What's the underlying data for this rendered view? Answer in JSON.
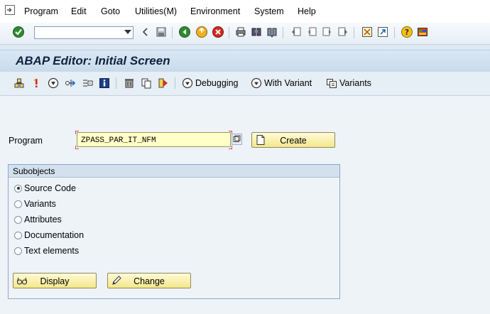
{
  "menu": {
    "items": [
      "Program",
      "Edit",
      "Goto",
      "Utilities(M)",
      "Environment",
      "System",
      "Help"
    ]
  },
  "system_toolbar": {
    "command_field_value": "",
    "icons": [
      "enter-icon",
      "back-nav-icon",
      "save-icon",
      "back-icon",
      "exit-icon",
      "cancel-icon",
      "print-icon",
      "find-icon",
      "find-next-icon",
      "first-page-icon",
      "prev-page-icon",
      "next-page-icon",
      "last-page-icon",
      "new-session-icon",
      "shortcut-icon",
      "help-icon",
      "customize-layout-icon"
    ]
  },
  "title": "ABAP Editor: Initial Screen",
  "app_toolbar": {
    "debugging_label": "Debugging",
    "with_variant_label": "With Variant",
    "variants_label": "Variants"
  },
  "form": {
    "program_label": "Program",
    "program_value": "ZPASS_PAR_IT_NFM",
    "create_label": "Create"
  },
  "subobjects": {
    "title": "Subobjects",
    "options": [
      {
        "label": "Source Code",
        "selected": true
      },
      {
        "label": "Variants",
        "selected": false
      },
      {
        "label": "Attributes",
        "selected": false
      },
      {
        "label": "Documentation",
        "selected": false
      },
      {
        "label": "Text elements",
        "selected": false
      }
    ],
    "display_label": "Display",
    "change_label": "Change"
  },
  "colors": {
    "background": "#dfe9f3",
    "title_text": "#10223e",
    "required_field": "#ffffc8",
    "button_fill": "#f5e78a"
  }
}
